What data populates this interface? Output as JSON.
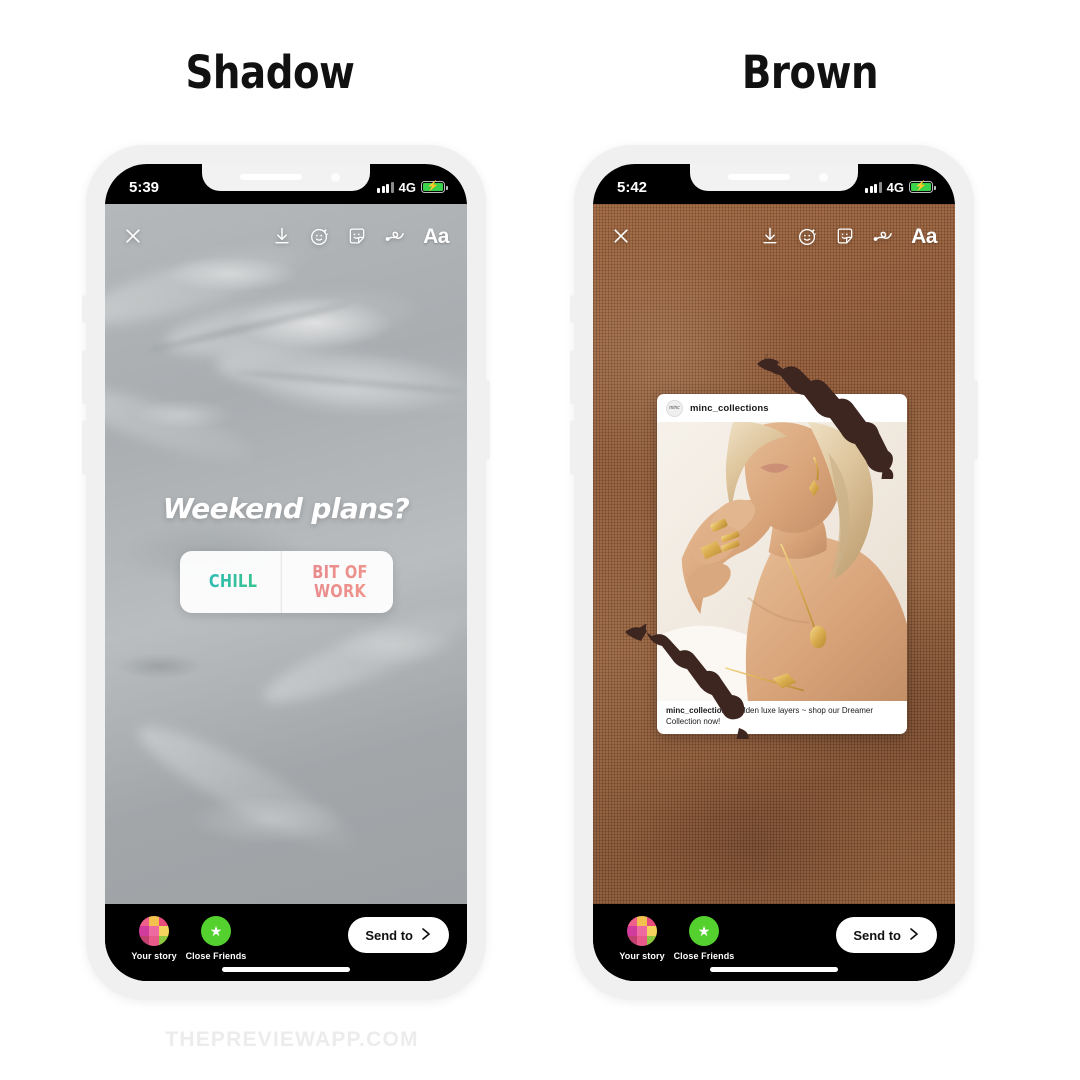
{
  "headings": [
    {
      "label": "Shadow"
    },
    {
      "label": "Brown"
    }
  ],
  "watermark": {
    "text": "THEPREVIEWAPP.COM"
  },
  "phones": [
    {
      "id": "shadow",
      "status_bar": {
        "time": "5:39",
        "network": "4G",
        "battery_state": "charging",
        "battery_icon": "battery-charging-icon",
        "signal_icon": "signal-bars-icon"
      },
      "background": {
        "name": "grey-palm-shadow",
        "color": "#aeb2b5"
      },
      "toolbar": {
        "close_label": "✕",
        "items": [
          {
            "name": "close-icon",
            "label": "Close"
          },
          {
            "name": "download-icon",
            "label": "Save"
          },
          {
            "name": "effects-face-icon",
            "label": "Effects"
          },
          {
            "name": "sticker-icon",
            "label": "Stickers"
          },
          {
            "name": "draw-squiggle-icon",
            "label": "Draw"
          },
          {
            "name": "text-aa-icon",
            "label": "Aa"
          }
        ]
      },
      "poll": {
        "question": "Weekend plans?",
        "option_a": "CHILL",
        "option_b": "BIT OF\nWORK",
        "option_a_color": "#2bb6c4",
        "option_b_color": "#e8848c"
      },
      "bottom_bar": {
        "your_story_label": "Your story",
        "close_friends_label": "Close Friends",
        "send_to_label": "Send to",
        "chevron": "›"
      }
    },
    {
      "id": "brown",
      "status_bar": {
        "time": "5:42",
        "network": "4G",
        "battery_state": "charging",
        "battery_icon": "battery-charging-icon",
        "signal_icon": "signal-bars-icon"
      },
      "background": {
        "name": "brown-canvas-texture",
        "color": "#8f5a36"
      },
      "toolbar": {
        "close_label": "✕",
        "items": [
          {
            "name": "close-icon",
            "label": "Close"
          },
          {
            "name": "download-icon",
            "label": "Save"
          },
          {
            "name": "effects-face-icon",
            "label": "Effects"
          },
          {
            "name": "sticker-icon",
            "label": "Stickers"
          },
          {
            "name": "draw-squiggle-icon",
            "label": "Draw"
          },
          {
            "name": "text-aa-icon",
            "label": "Aa"
          }
        ]
      },
      "shared_post": {
        "username": "minc_collections",
        "avatar_text": "minc",
        "caption_user": "minc_collections",
        "caption_text": " Golden luxe layers ~ shop our Dreamer Collection now!"
      },
      "brush_strokes": {
        "color": "#3d2520",
        "count": 2
      },
      "bottom_bar": {
        "your_story_label": "Your story",
        "close_friends_label": "Close Friends",
        "send_to_label": "Send to",
        "chevron": "›"
      }
    }
  ]
}
